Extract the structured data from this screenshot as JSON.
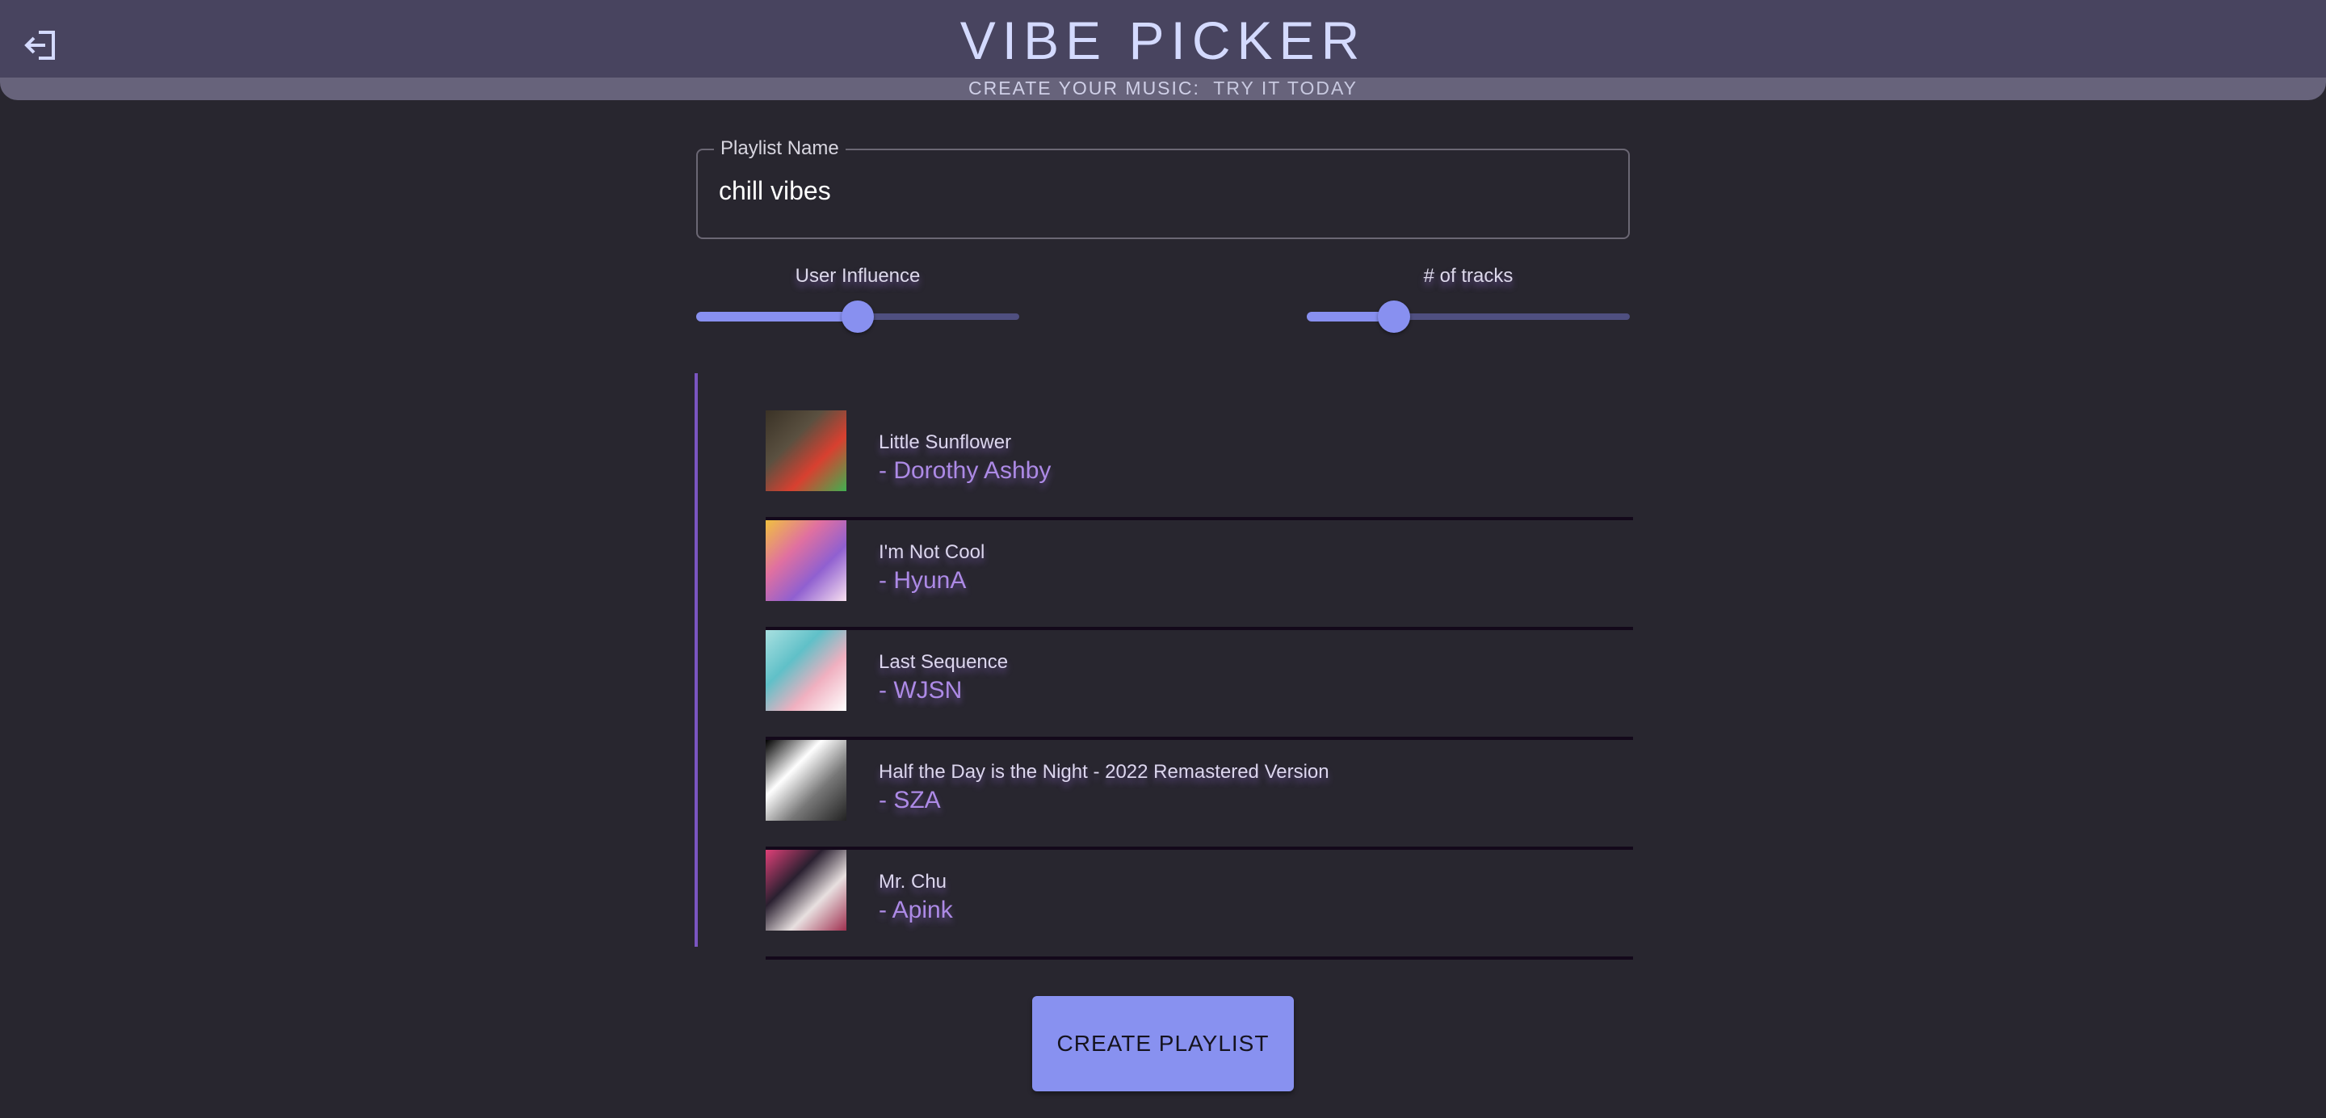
{
  "header": {
    "title": "VIBE PICKER",
    "subtitle_a": "CREATE YOUR MUSIC:",
    "subtitle_b": "TRY IT TODAY",
    "logout_icon": "logout-icon"
  },
  "form": {
    "playlist_label": "Playlist Name",
    "playlist_value": "chill vibes",
    "user_influence": {
      "label": "User Influence",
      "value_percent": 50
    },
    "num_tracks": {
      "label": "# of tracks",
      "value_percent": 27
    }
  },
  "tracks": [
    {
      "title": "Little Sunflower",
      "artist": "- Dorothy Ashby",
      "cover_colors": [
        "#3a3226",
        "#5a5040",
        "#d84030",
        "#40b050"
      ]
    },
    {
      "title": "I'm Not Cool",
      "artist": "- HyunA",
      "cover_colors": [
        "#f0c040",
        "#e070a0",
        "#9060d0",
        "#f8e0f0"
      ]
    },
    {
      "title": "Last Sequence",
      "artist": "- WJSN",
      "cover_colors": [
        "#a8e0e0",
        "#60c0c8",
        "#f0b0c0",
        "#ffffff"
      ]
    },
    {
      "title": "Half the Day is the Night - 2022 Remastered Version",
      "artist": "- SZA",
      "cover_colors": [
        "#000000",
        "#ffffff",
        "#777777",
        "#222222"
      ]
    },
    {
      "title": "Mr. Chu",
      "artist": "- Apink",
      "cover_colors": [
        "#e04078",
        "#2a2030",
        "#e8e0e0",
        "#a03050"
      ]
    }
  ],
  "create_button": "CREATE PLAYLIST"
}
